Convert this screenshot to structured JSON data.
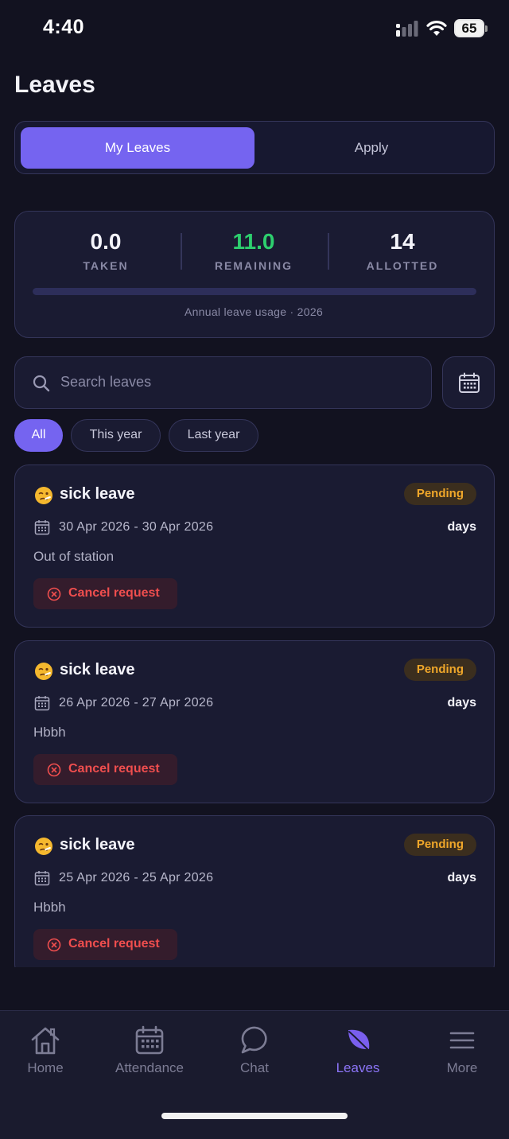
{
  "status_bar": {
    "time": "4:40",
    "battery": "65"
  },
  "page": {
    "title": "Leaves"
  },
  "tabs": [
    {
      "label": "My Leaves",
      "active": true
    },
    {
      "label": "Apply",
      "active": false
    }
  ],
  "stats": {
    "taken": {
      "value": "0.0",
      "label": "TAKEN"
    },
    "remaining": {
      "value": "11.0",
      "label": "REMAINING"
    },
    "allotted": {
      "value": "14",
      "label": "ALLOTTED"
    },
    "usage_fraction": 0,
    "usage_caption": "Annual leave usage · 2026"
  },
  "search": {
    "placeholder": "Search leaves",
    "value": ""
  },
  "filters": [
    {
      "label": "All",
      "active": true
    },
    {
      "label": "This year",
      "active": false
    },
    {
      "label": "Last year",
      "active": false
    }
  ],
  "leaves": [
    {
      "emoji": "🤒",
      "type": "sick leave",
      "status": "Pending",
      "dates": "30 Apr 2026 - 30 Apr 2026",
      "days": "days",
      "reason": "Out of station",
      "cancel_label": "Cancel request"
    },
    {
      "emoji": "🤒",
      "type": "sick leave",
      "status": "Pending",
      "dates": "26 Apr 2026 - 27 Apr 2026",
      "days": "days",
      "reason": "Hbbh",
      "cancel_label": "Cancel request"
    },
    {
      "emoji": "🤒",
      "type": "sick leave",
      "status": "Pending",
      "dates": "25 Apr 2026 - 25 Apr 2026",
      "days": "days",
      "reason": "Hbbh",
      "cancel_label": "Cancel request"
    }
  ],
  "nav": [
    {
      "label": "Home",
      "icon": "home-icon",
      "active": false
    },
    {
      "label": "Attendance",
      "icon": "calendar-icon",
      "active": false
    },
    {
      "label": "Chat",
      "icon": "chat-icon",
      "active": false
    },
    {
      "label": "Leaves",
      "icon": "leaf-icon",
      "active": true
    },
    {
      "label": "More",
      "icon": "menu-icon",
      "active": false
    }
  ],
  "colors": {
    "accent": "#7564f0",
    "green": "#2dcf6e",
    "pending": "#f0a72a",
    "danger": "#ef4e4e"
  }
}
